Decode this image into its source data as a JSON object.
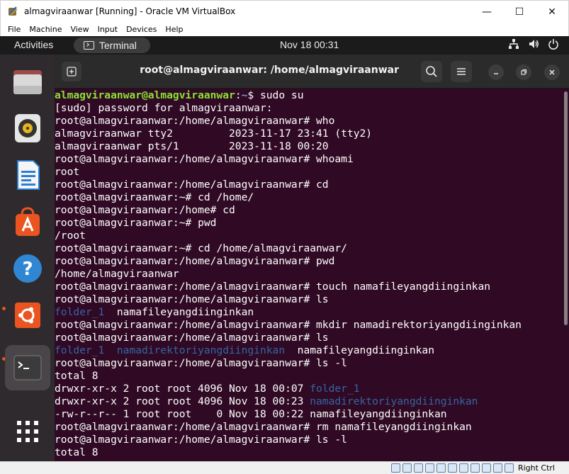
{
  "window": {
    "title": "almagviraanwar [Running] - Oracle VM VirtualBox",
    "controls": {
      "minimize": "—",
      "maximize": "☐",
      "close": "✕"
    }
  },
  "vbox_menu": [
    "File",
    "Machine",
    "View",
    "Input",
    "Devices",
    "Help"
  ],
  "gnome": {
    "activities": "Activities",
    "app_name": "Terminal",
    "clock": "Nov 18  00:31",
    "tray_icons": [
      "network-icon",
      "volume-icon",
      "power-icon"
    ]
  },
  "dock": {
    "items": [
      {
        "name": "files-icon"
      },
      {
        "name": "rhythmbox-icon"
      },
      {
        "name": "libreoffice-writer-icon"
      },
      {
        "name": "software-center-icon"
      },
      {
        "name": "help-icon"
      },
      {
        "name": "ubuntu-icon"
      },
      {
        "name": "terminal-icon"
      },
      {
        "name": "show-apps-icon"
      }
    ]
  },
  "terminal": {
    "title": "root@almagviraanwar: /home/almagviraanwar",
    "lines": [
      [
        {
          "t": "almagviraanwar@almagviraanwar",
          "c": "user"
        },
        {
          "t": ":",
          "c": ""
        },
        {
          "t": "~",
          "c": "path"
        },
        {
          "t": "$ sudo su",
          "c": ""
        }
      ],
      [
        {
          "t": "[sudo] password for almagviraanwar:",
          "c": ""
        }
      ],
      [
        {
          "t": "root@almagviraanwar:/home/almagviraanwar# who",
          "c": ""
        }
      ],
      [
        {
          "t": "almagviraanwar tty2         2023-11-17 23:41 (tty2)",
          "c": ""
        }
      ],
      [
        {
          "t": "almagviraanwar pts/1        2023-11-18 00:20",
          "c": ""
        }
      ],
      [
        {
          "t": "root@almagviraanwar:/home/almagviraanwar# whoami",
          "c": ""
        }
      ],
      [
        {
          "t": "root",
          "c": ""
        }
      ],
      [
        {
          "t": "root@almagviraanwar:/home/almagviraanwar# cd",
          "c": ""
        }
      ],
      [
        {
          "t": "root@almagviraanwar:~# cd /home/",
          "c": ""
        }
      ],
      [
        {
          "t": "root@almagviraanwar:/home# cd",
          "c": ""
        }
      ],
      [
        {
          "t": "root@almagviraanwar:~# pwd",
          "c": ""
        }
      ],
      [
        {
          "t": "/root",
          "c": ""
        }
      ],
      [
        {
          "t": "root@almagviraanwar:~# cd /home/almagviraanwar/",
          "c": ""
        }
      ],
      [
        {
          "t": "root@almagviraanwar:/home/almagviraanwar# pwd",
          "c": ""
        }
      ],
      [
        {
          "t": "/home/almagviraanwar",
          "c": ""
        }
      ],
      [
        {
          "t": "root@almagviraanwar:/home/almagviraanwar# touch namafileyangdiinginkan",
          "c": ""
        }
      ],
      [
        {
          "t": "root@almagviraanwar:/home/almagviraanwar# ls",
          "c": ""
        }
      ],
      [
        {
          "t": "folder_1",
          "c": "dir"
        },
        {
          "t": "  namafileyangdiinginkan",
          "c": ""
        }
      ],
      [
        {
          "t": "root@almagviraanwar:/home/almagviraanwar# mkdir namadirektoriyangdiinginkan",
          "c": ""
        }
      ],
      [
        {
          "t": "root@almagviraanwar:/home/almagviraanwar# ls",
          "c": ""
        }
      ],
      [
        {
          "t": "folder_1",
          "c": "dir"
        },
        {
          "t": "  ",
          "c": ""
        },
        {
          "t": "namadirektoriyangdiinginkan",
          "c": "dir"
        },
        {
          "t": "  namafileyangdiinginkan",
          "c": ""
        }
      ],
      [
        {
          "t": "root@almagviraanwar:/home/almagviraanwar# ls -l",
          "c": ""
        }
      ],
      [
        {
          "t": "total 8",
          "c": ""
        }
      ],
      [
        {
          "t": "drwxr-xr-x 2 root root 4096 Nov 18 00:07 ",
          "c": ""
        },
        {
          "t": "folder_1",
          "c": "dir"
        }
      ],
      [
        {
          "t": "drwxr-xr-x 2 root root 4096 Nov 18 00:23 ",
          "c": ""
        },
        {
          "t": "namadirektoriyangdiinginkan",
          "c": "dir"
        }
      ],
      [
        {
          "t": "-rw-r--r-- 1 root root    0 Nov 18 00:22 namafileyangdiinginkan",
          "c": ""
        }
      ],
      [
        {
          "t": "root@almagviraanwar:/home/almagviraanwar# rm namafileyangdiinginkan",
          "c": ""
        }
      ],
      [
        {
          "t": "root@almagviraanwar:/home/almagviraanwar# ls -l",
          "c": ""
        }
      ],
      [
        {
          "t": "total 8",
          "c": ""
        }
      ]
    ]
  },
  "statusbar": {
    "host_key": "Right Ctrl",
    "icons": [
      "hdd-icon",
      "optical-icon",
      "audio-icon",
      "network-icon",
      "usb-icon",
      "shared-folder-icon",
      "display-icon",
      "recording-icon",
      "mouse-icon",
      "cpu-icon",
      "keyboard-icon"
    ]
  },
  "colors": {
    "terminal_bg": "#300a24",
    "prompt_user": "#8ae234",
    "prompt_path": "#729fcf",
    "directory": "#3465a4",
    "accent": "#e95420"
  }
}
